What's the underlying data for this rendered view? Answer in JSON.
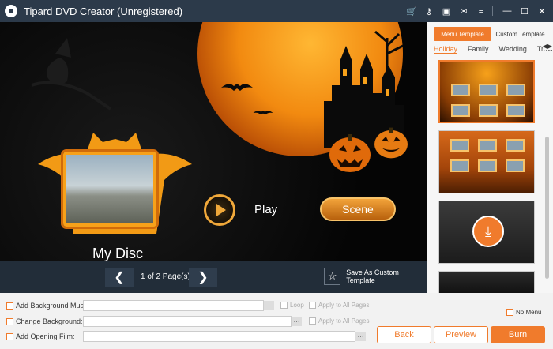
{
  "app": {
    "title": "Tipard DVD Creator (Unregistered)",
    "toolbar_icons": [
      "cart-icon",
      "key-icon",
      "save-icon",
      "feedback-icon",
      "menu-icon",
      "minimize-icon",
      "maximize-icon",
      "close-icon"
    ]
  },
  "preview": {
    "disc_title": "My Disc",
    "play_label": "Play",
    "scene_label": "Scene"
  },
  "nav": {
    "prev_label": "❮",
    "next_label": "❯",
    "page_info": "1 of 2 Page(s)",
    "save_template_label": "Save As Custom Template"
  },
  "panel": {
    "tabs": [
      "Menu Template",
      "Custom Template"
    ],
    "active_tab": "Menu Template",
    "categories": [
      "Holiday",
      "Family",
      "Wedding",
      "Travel"
    ],
    "active_category": "Holiday"
  },
  "settings": {
    "bg_music_label": "Add Background Music:",
    "bg_music_value": "",
    "loop_label": "Loop",
    "apply_all_label": "Apply to All Pages",
    "change_bg_label": "Change Background:",
    "change_bg_value": "",
    "apply_all_label_2": "Apply to All Pages",
    "opening_film_label": "Add Opening Film:",
    "opening_film_value": "",
    "browse_label": "···",
    "no_menu_label": "No Menu"
  },
  "buttons": {
    "back": "Back",
    "preview": "Preview",
    "burn": "Burn"
  },
  "colors": {
    "accent": "#f07b2c",
    "titlebar": "#2c3a4a",
    "navbar": "#222d39"
  }
}
